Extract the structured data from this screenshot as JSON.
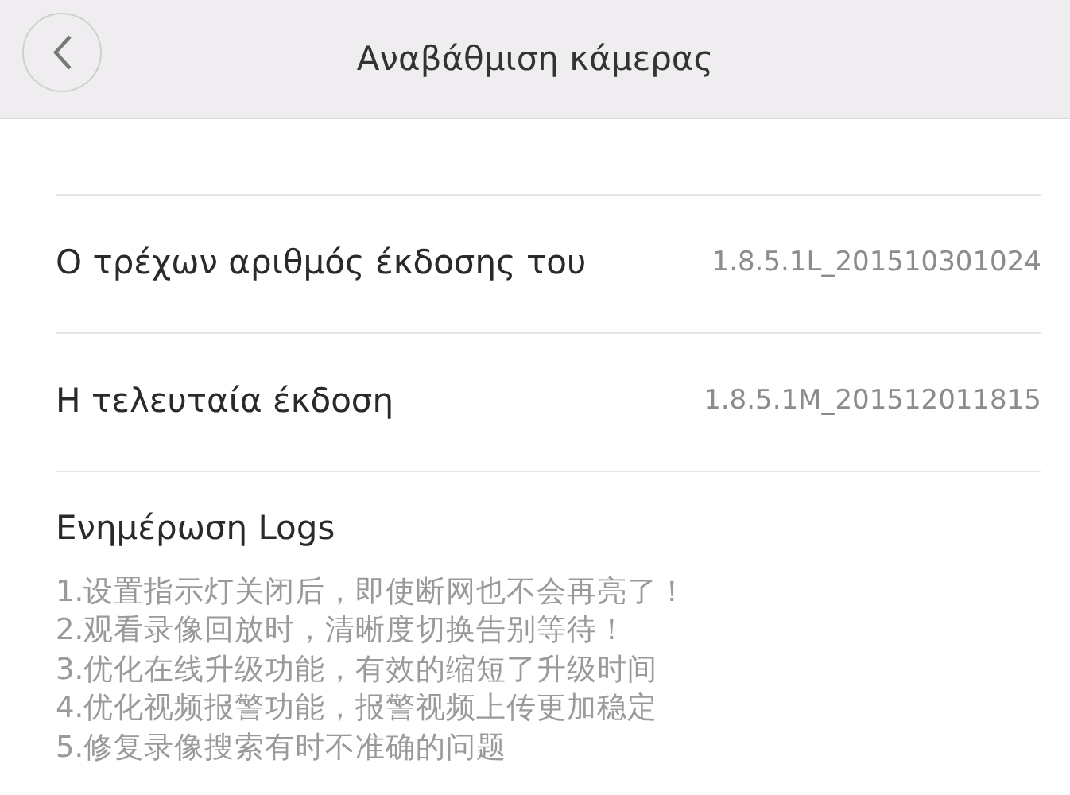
{
  "header": {
    "title": "Αναβάθμιση κάμερας"
  },
  "versions": [
    {
      "label": "Ο τρέχων αριθμός έκδοσης του",
      "value": "1.8.5.1L_201510301024"
    },
    {
      "label": "Η τελευταία έκδοση",
      "value": "1.8.5.1M_201512011815"
    }
  ],
  "logs": {
    "title": "Ενημέρωση Logs",
    "lines": [
      "1.设置指示灯关闭后，即使断网也不会再亮了！",
      "2.观看录像回放时，清晰度切换告别等待！",
      "3.优化在线升级功能，有效的缩短了升级时间",
      "4.优化视频报警功能，报警视频上传更加稳定",
      "5.修复录像搜索有时不准确的问题"
    ]
  }
}
